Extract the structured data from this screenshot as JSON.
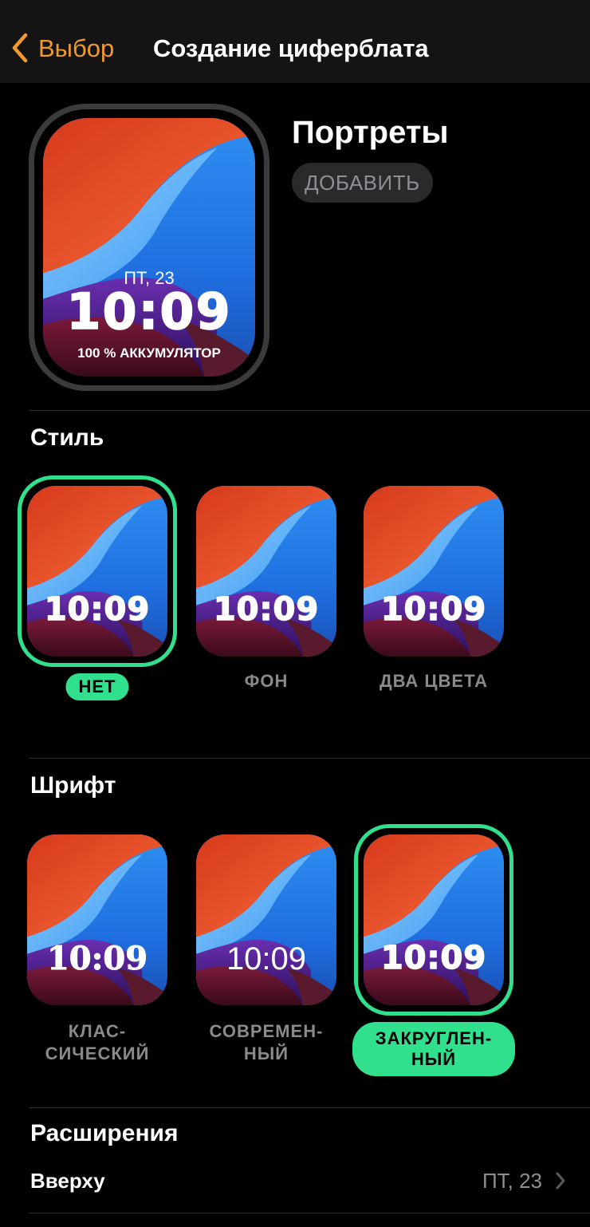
{
  "nav": {
    "back_label": "Выбор",
    "title": "Создание циферблата"
  },
  "preview": {
    "title": "Портреты",
    "add_label": "ДОБАВИТЬ",
    "date": "ПТ, 23",
    "time": "10:09",
    "battery": "100 % АККУМУЛЯТОР"
  },
  "style_section": {
    "title": "Стиль",
    "options": [
      {
        "label": "НЕТ",
        "time": "10:09",
        "selected": true
      },
      {
        "label": "ФОН",
        "time": "10:09",
        "selected": false
      },
      {
        "label": "ДВА ЦВЕТА",
        "time": "10:09",
        "selected": false
      }
    ]
  },
  "font_section": {
    "title": "Шрифт",
    "options": [
      {
        "label_line1": "КЛАС-",
        "label_line2": "СИЧЕСКИЙ",
        "time": "10:09",
        "selected": false
      },
      {
        "label_line1": "СОВРЕМЕН-",
        "label_line2": "НЫЙ",
        "time": "10:09",
        "selected": false
      },
      {
        "label_line1": "ЗАКРУГЛЕН-",
        "label_line2": "НЫЙ",
        "time": "10:09",
        "selected": true
      }
    ]
  },
  "extensions_section": {
    "title": "Расширения",
    "rows": [
      {
        "label": "Вверху",
        "value": "ПТ, 23"
      }
    ]
  },
  "colors": {
    "accent_orange": "#f09a2e",
    "selection_green": "#30e08c",
    "secondary_text": "#8e8e93"
  }
}
